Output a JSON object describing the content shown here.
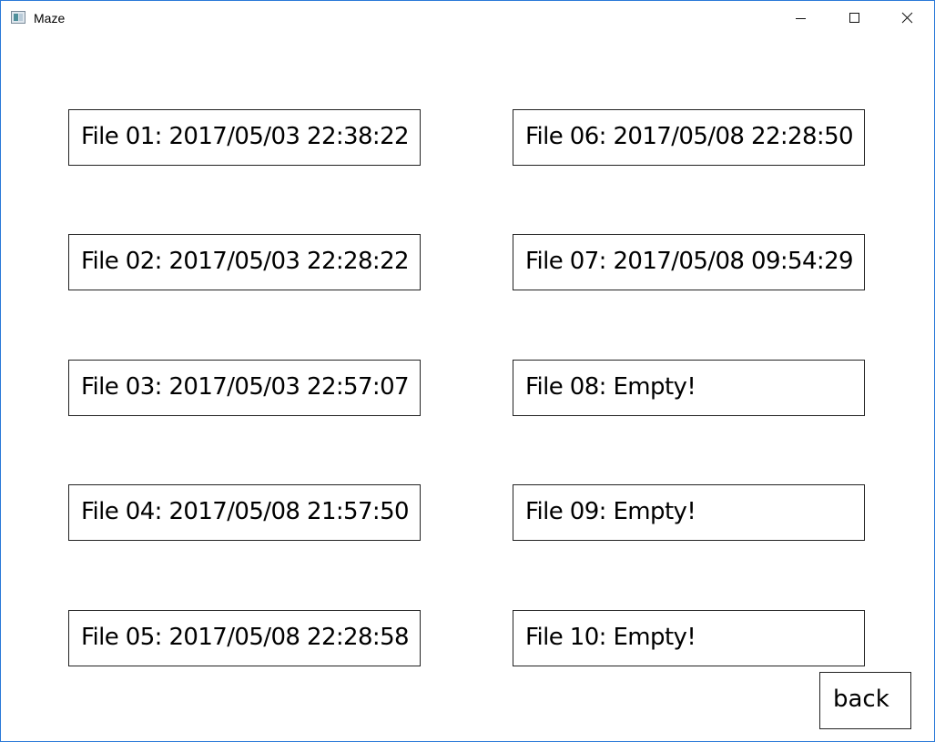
{
  "window": {
    "title": "Maze",
    "border_color": "#2b79d8"
  },
  "titlebar_icons": {
    "app": "window-icon",
    "minimize": "minimize-icon",
    "maximize": "maximize-icon",
    "close": "close-icon"
  },
  "save_slots": [
    {
      "label": "File 01: 2017/05/03 22:38:22"
    },
    {
      "label": "File 02: 2017/05/03 22:28:22"
    },
    {
      "label": "File 03: 2017/05/03 22:57:07"
    },
    {
      "label": "File 04: 2017/05/08 21:57:50"
    },
    {
      "label": "File 05: 2017/05/08 22:28:58"
    },
    {
      "label": "File 06: 2017/05/08 22:28:50"
    },
    {
      "label": "File 07: 2017/05/08 09:54:29"
    },
    {
      "label": "File 08: Empty!"
    },
    {
      "label": "File 09: Empty!"
    },
    {
      "label": "File 10: Empty!"
    }
  ],
  "back_button": {
    "label": "back"
  }
}
